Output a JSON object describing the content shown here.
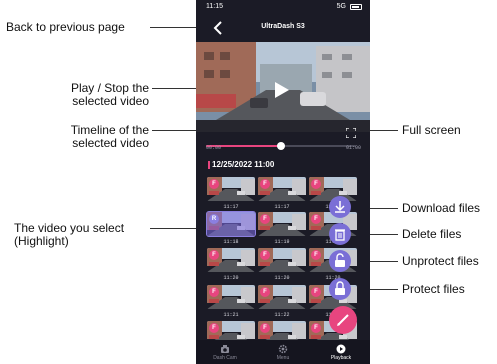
{
  "phone": {
    "status_time": "11:15",
    "status_signal": "5G",
    "nav_title": "UltraDash S3",
    "timeline": {
      "start_label": "00:00",
      "end_label": "01:00",
      "progress": 0.5
    },
    "date_header": "12/25/2022 11:00",
    "thumbnails": [
      {
        "time": "11:17",
        "badge": "F",
        "selected": false
      },
      {
        "time": "11:17",
        "badge": "F",
        "selected": false
      },
      {
        "time": "11:17",
        "badge": "F",
        "selected": false
      },
      {
        "time": "11:18",
        "badge": "R",
        "selected": true
      },
      {
        "time": "11:19",
        "badge": "F",
        "selected": false
      },
      {
        "time": "11:19",
        "badge": "F",
        "selected": false
      },
      {
        "time": "11:20",
        "badge": "F",
        "selected": false
      },
      {
        "time": "11:20",
        "badge": "F",
        "selected": false
      },
      {
        "time": "11:20",
        "badge": "F",
        "selected": false
      },
      {
        "time": "11:21",
        "badge": "F",
        "selected": false
      },
      {
        "time": "11:22",
        "badge": "F",
        "selected": false
      },
      {
        "time": "11:22",
        "badge": "F",
        "selected": false
      },
      {
        "time": "",
        "badge": "F",
        "selected": false
      },
      {
        "time": "",
        "badge": "F",
        "selected": false
      },
      {
        "time": "",
        "badge": "F",
        "selected": false
      }
    ],
    "tabs": [
      {
        "label": "Dash Cam",
        "icon": "dashcam-icon",
        "active": false
      },
      {
        "label": "Menu",
        "icon": "gear-icon",
        "active": false
      },
      {
        "label": "Playback",
        "icon": "play-circle-icon",
        "active": true
      }
    ],
    "fabs": [
      "download-icon",
      "trash-icon",
      "unlock-icon",
      "lock-icon",
      "pencil-icon"
    ]
  },
  "annotations": {
    "back": "Back to previous page",
    "play_stop_line1": "Play / Stop the",
    "play_stop_line2": "selected video",
    "timeline_line1": "Timeline of the",
    "timeline_line2": "selected video",
    "full_screen": "Full screen",
    "selected_line1": "The video you select",
    "selected_line2": "(Highlight)",
    "download": "Download files",
    "delete": "Delete files",
    "unprotect": "Unprotect files",
    "protect": "Protect files"
  },
  "colors": {
    "accent": "#e8457f",
    "fab": "#7a6fd6",
    "background": "#1b1b26"
  }
}
